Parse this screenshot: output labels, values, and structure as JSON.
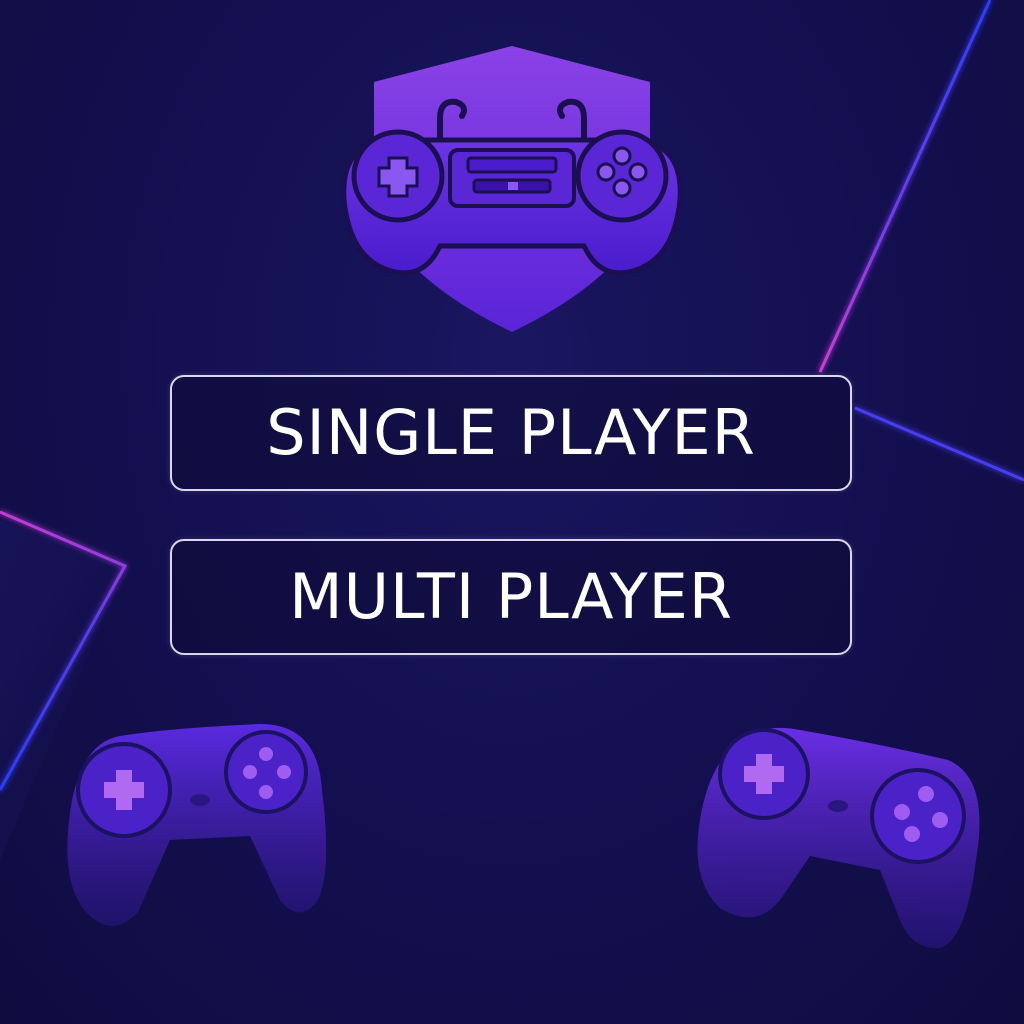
{
  "menu": {
    "single_player_label": "SINGLE PLAYER",
    "multi_player_label": "MULTI PLAYER"
  },
  "icons": {
    "logo": "shield-gamepad-icon",
    "left_decoration": "gamepad-icon",
    "right_decoration": "gamepad-icon"
  },
  "colors": {
    "background": "#13104a",
    "accent_purple": "#6a2fe0",
    "button_border": "#d9d6ee",
    "neon_blue": "#2a3cff",
    "neon_pink": "#c43cd6"
  }
}
